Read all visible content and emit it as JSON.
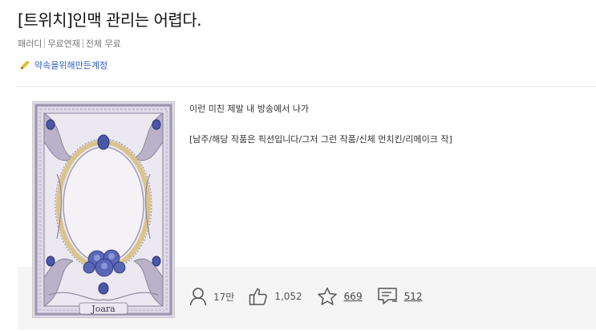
{
  "title": "[트위치]인맥 관리는 어렵다.",
  "meta": {
    "genre": "패러디",
    "pricing": "무료연재",
    "access": "전체 무료"
  },
  "author": {
    "name": "약속을위해만든계정",
    "icon": "pencil-icon"
  },
  "cover": {
    "watermark": "Joara"
  },
  "description": {
    "line1": "이런 미친 제발 내 방송에서 나가",
    "line2": "[남주/해당 작품은 픽션입니다/그저 그런 작품/신체 먼치킨/리메이크 작]"
  },
  "stats": {
    "views": "17만",
    "likes": "1,052",
    "favorites": "669",
    "comments": "512"
  },
  "colors": {
    "accent": "#2c5cc5",
    "stats_bg": "#f5f5f5"
  }
}
